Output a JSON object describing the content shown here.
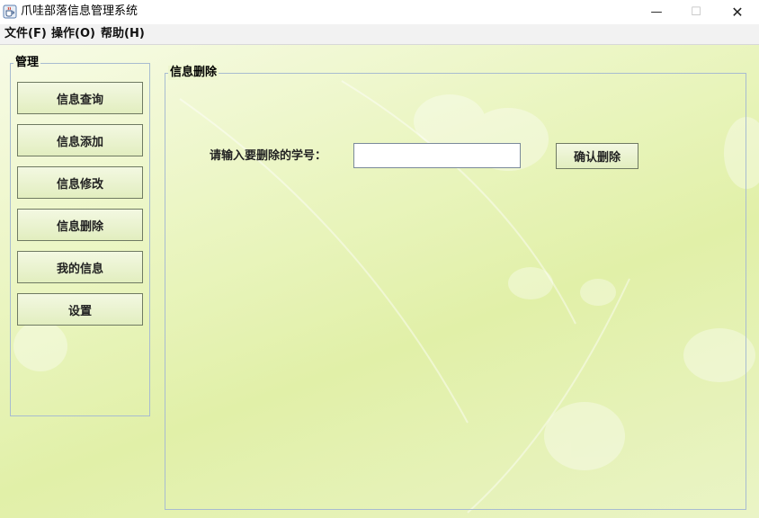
{
  "window": {
    "title": "爪哇部落信息管理系统",
    "minimize_glyph": "—",
    "maximize_glyph": "☐",
    "close_glyph": "✕"
  },
  "menubar": {
    "items": [
      {
        "label": "文件(F)"
      },
      {
        "label": "操作(O)"
      },
      {
        "label": "帮助(H)"
      }
    ]
  },
  "sidebar": {
    "title": "管理",
    "buttons": [
      {
        "label": "信息查询"
      },
      {
        "label": "信息添加"
      },
      {
        "label": "信息修改"
      },
      {
        "label": "信息删除"
      },
      {
        "label": "我的信息"
      },
      {
        "label": "设置"
      }
    ]
  },
  "panel": {
    "title": "信息删除",
    "prompt": "请输入要删除的学号：",
    "input_value": "",
    "confirm_label": "确认删除"
  },
  "colors": {
    "background": "#e6f2b6",
    "border": "#a8bcd0"
  },
  "icons": {
    "app": "java-cup-icon"
  }
}
